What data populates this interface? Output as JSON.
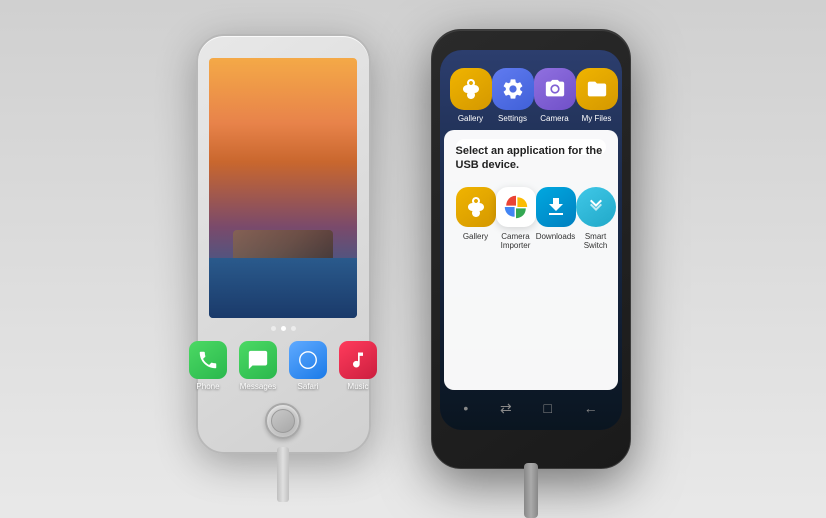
{
  "scene": {
    "background": "#e0e0e0"
  },
  "iphone": {
    "apps": [
      {
        "id": "phone",
        "label": "Phone",
        "cssClass": "app-phone",
        "icon": "📞"
      },
      {
        "id": "messages",
        "label": "Messages",
        "cssClass": "app-messages",
        "icon": "💬"
      },
      {
        "id": "safari",
        "label": "Safari",
        "cssClass": "app-safari",
        "icon": "🧭"
      },
      {
        "id": "music",
        "label": "Music",
        "cssClass": "app-music",
        "icon": "🎵"
      }
    ]
  },
  "samsung": {
    "topApps": [
      {
        "id": "gallery",
        "label": "Gallery",
        "cssClass": "s-gallery"
      },
      {
        "id": "settings",
        "label": "Settings",
        "cssClass": "s-settings"
      },
      {
        "id": "camera",
        "label": "Camera",
        "cssClass": "s-camera"
      },
      {
        "id": "myfiles",
        "label": "My Files",
        "cssClass": "s-myfiles"
      }
    ],
    "dialog": {
      "title": "Select an application for the USB device.",
      "apps": [
        {
          "id": "gallery",
          "label": "Gallery",
          "cssClass": "d-gallery"
        },
        {
          "id": "camera-importer",
          "label": "Camera\nImporter",
          "cssClass": "d-cameraimp"
        },
        {
          "id": "downloads",
          "label": "Downloads",
          "cssClass": "d-downloads"
        },
        {
          "id": "smart-switch",
          "label": "Smart Switch",
          "cssClass": "d-smartswitch"
        }
      ]
    }
  }
}
